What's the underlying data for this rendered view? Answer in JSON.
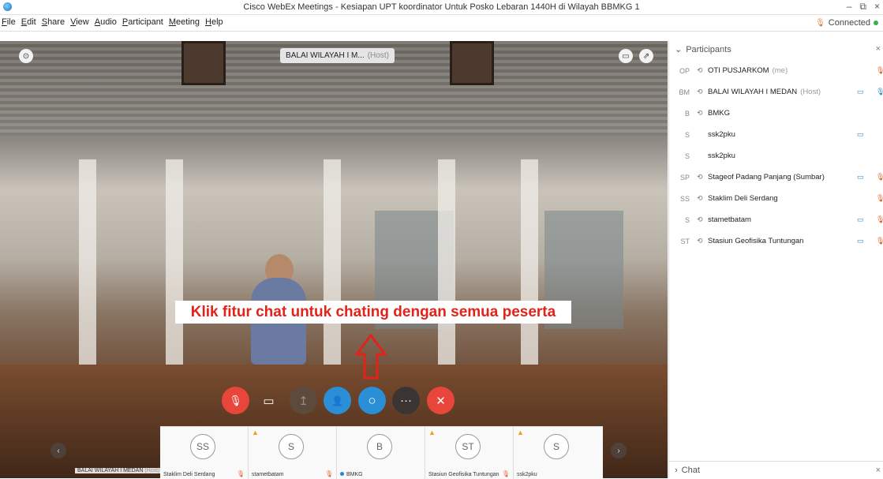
{
  "window": {
    "title": "Cisco WebEx Meetings - Kesiapan UPT koordinator Untuk Posko Lebaran 1440H di Wilayah BBMKG 1",
    "minimize": "–",
    "restore": "⧉",
    "close": "×"
  },
  "menu": [
    "File",
    "Edit",
    "Share",
    "View",
    "Audio",
    "Participant",
    "Meeting",
    "Help"
  ],
  "status": {
    "connection": "Connected",
    "connected_color": "#2fb54a"
  },
  "video": {
    "host_name": "BALAI WILAYAH I M...",
    "host_tag": "(Host)",
    "annotation": "Klik fitur chat untuk chating dengan semua peserta",
    "annotation_color": "#e2231a"
  },
  "controls": [
    {
      "id": "mute",
      "icon": "microphone-muted-icon",
      "glyph": "🎙",
      "color": "#e8463b"
    },
    {
      "id": "video",
      "icon": "video-camera-icon",
      "glyph": "▭",
      "color": "transparent"
    },
    {
      "id": "share",
      "icon": "share-screen-icon",
      "glyph": "↥",
      "color": "#5c4a3c"
    },
    {
      "id": "participants",
      "icon": "participants-icon",
      "glyph": "👤",
      "color": "#2a8fd6"
    },
    {
      "id": "chat",
      "icon": "chat-icon",
      "glyph": "○",
      "color": "#2a8fd6"
    },
    {
      "id": "more",
      "icon": "more-options-icon",
      "glyph": "···",
      "color": "#3a3533"
    },
    {
      "id": "leave",
      "icon": "leave-meeting-icon",
      "glyph": "✕",
      "color": "#e8463b"
    }
  ],
  "thumbnails": [
    {
      "initials": "SS",
      "label": "Staklim Deli Serdang",
      "warn": false,
      "mic": true
    },
    {
      "initials": "S",
      "label": "stametbatam",
      "warn": true,
      "mic": true
    },
    {
      "initials": "B",
      "label": "BMKG",
      "warn": false,
      "mic": false
    },
    {
      "initials": "ST",
      "label": "Stasiun Geofisika Tuntungan",
      "warn": true,
      "mic": true
    },
    {
      "initials": "S",
      "label": "ssk2pku",
      "warn": true,
      "mic": false
    }
  ],
  "thumb_host_label": {
    "name": "BALAI WILAYAH I MEDAN",
    "tag": "(Host)"
  },
  "panel": {
    "participants_title": "Participants",
    "chat_title": "Chat",
    "participants": [
      {
        "initials": "OP",
        "audio": true,
        "name": "OTI PUSJARKOM",
        "tag": "(me)",
        "video": false,
        "mic": "red"
      },
      {
        "initials": "BM",
        "audio": true,
        "name": "BALAI WILAYAH I MEDAN",
        "tag": "(Host)",
        "video": true,
        "mic": "blue"
      },
      {
        "initials": "B",
        "audio": true,
        "name": "BMKG",
        "tag": "",
        "video": false,
        "mic": ""
      },
      {
        "initials": "S",
        "audio": false,
        "name": "ssk2pku",
        "tag": "",
        "video": true,
        "mic": ""
      },
      {
        "initials": "S",
        "audio": false,
        "name": "ssk2pku",
        "tag": "",
        "video": false,
        "mic": ""
      },
      {
        "initials": "SP",
        "audio": true,
        "name": "Stageof Padang Panjang (Sumbar)",
        "tag": "",
        "video": true,
        "mic": "red"
      },
      {
        "initials": "SS",
        "audio": true,
        "name": "Staklim Deli Serdang",
        "tag": "",
        "video": false,
        "mic": "red"
      },
      {
        "initials": "S",
        "audio": true,
        "name": "stametbatam",
        "tag": "",
        "video": true,
        "mic": "red"
      },
      {
        "initials": "ST",
        "audio": true,
        "name": "Stasiun Geofisika Tuntungan",
        "tag": "",
        "video": true,
        "mic": "red"
      }
    ]
  }
}
